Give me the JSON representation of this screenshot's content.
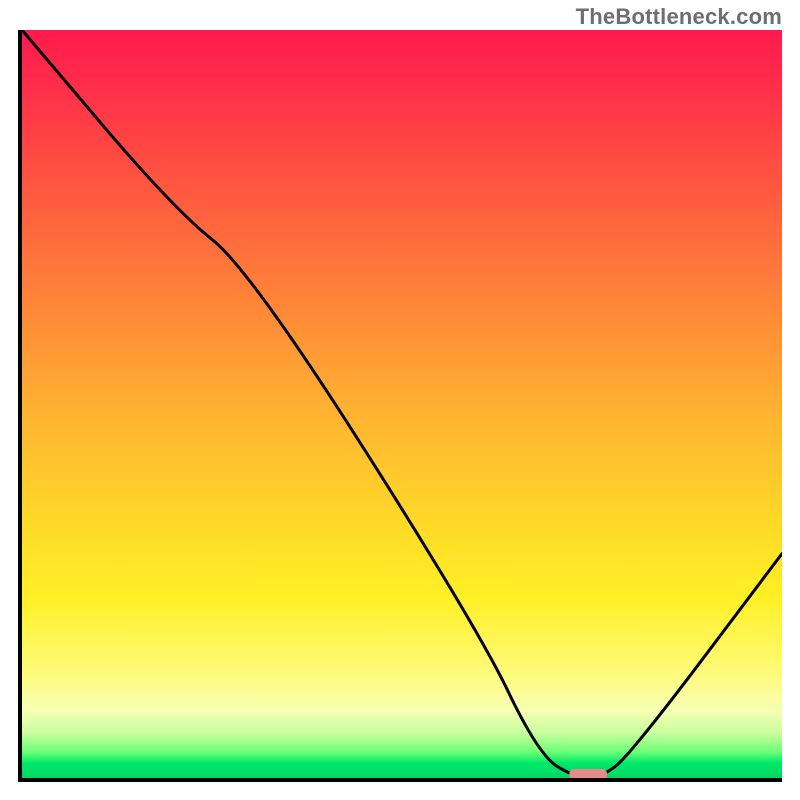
{
  "watermark": "TheBottleneck.com",
  "chart_data": {
    "type": "line",
    "title": "",
    "xlabel": "",
    "ylabel": "",
    "xlim": [
      0,
      100
    ],
    "ylim": [
      0,
      100
    ],
    "grid": false,
    "legend": null,
    "series": [
      {
        "name": "bottleneck-curve",
        "x": [
          0,
          20,
          30,
          60,
          68,
          73,
          76,
          80,
          100
        ],
        "values": [
          100,
          76,
          68,
          20,
          3,
          0,
          0,
          3,
          30
        ]
      }
    ],
    "marker": {
      "name": "optimal-point",
      "x": 74.5,
      "y": 0,
      "width": 5,
      "color": "#e88a8a"
    },
    "background_gradient": {
      "stops": [
        {
          "pos": 0,
          "color": "#ff1a4c"
        },
        {
          "pos": 38,
          "color": "#ff8a38"
        },
        {
          "pos": 65,
          "color": "#ffd728"
        },
        {
          "pos": 91,
          "color": "#f6ffb3"
        },
        {
          "pos": 100,
          "color": "#00d860"
        }
      ]
    }
  }
}
